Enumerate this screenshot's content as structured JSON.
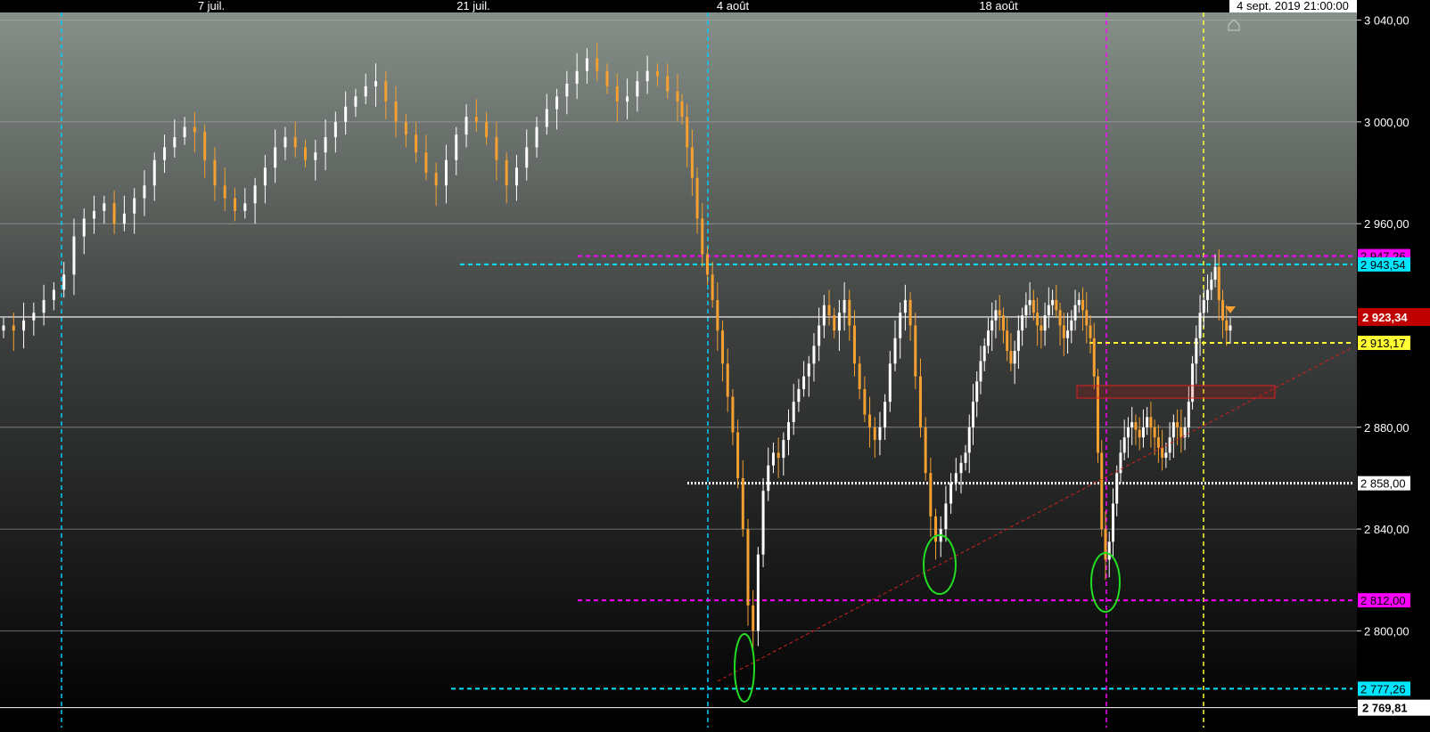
{
  "chart_data": {
    "type": "candlestick",
    "x_ticks": [
      "7 juil.",
      "21 juil.",
      "4 août",
      "18 août"
    ],
    "cursor_label": "4 sept. 2019 21:00:00",
    "y_ticks": [
      "3 040,00",
      "3 000,00",
      "2 960,00",
      "2 880,00",
      "2 840,00",
      "2 800,00"
    ],
    "ylim": [
      2762,
      3043
    ],
    "last_price": {
      "value": 2923.34,
      "label": "2 923,34"
    },
    "bottom_value": {
      "value": 2769.81,
      "label": "2 769,81"
    },
    "levels": [
      {
        "value": 2947.26,
        "label": "2 947,26",
        "color": "#ff00ff",
        "style": "dashed"
      },
      {
        "value": 2944.0,
        "label": "2 943,54",
        "color": "#00e5ff",
        "style": "dashed"
      },
      {
        "value": 2913.17,
        "label": "2 913,17",
        "color": "#ffff33",
        "style": "dashed"
      },
      {
        "value": 2858.0,
        "label": "2 858,00",
        "color": "#ffffff",
        "style": "dotted"
      },
      {
        "value": 2812.0,
        "label": "2 812,00",
        "color": "#ff00ff",
        "style": "dashed"
      },
      {
        "value": 2777.26,
        "label": "2 777,26",
        "color": "#00e5ff",
        "style": "dashed"
      }
    ],
    "series": [
      {
        "trend": "jul-up",
        "values": [
          2920,
          2918,
          2922,
          2925,
          2930,
          2934,
          2940,
          2955,
          2962,
          2965,
          2968,
          2960,
          2964,
          2970,
          2975,
          2985,
          2990,
          2994,
          2998,
          2996,
          2985,
          2975,
          2970,
          2965,
          2968,
          2975,
          2982,
          2990,
          2994,
          2990,
          2985,
          2988,
          2994,
          3000,
          3006,
          3010,
          3014,
          3016,
          3008,
          3000,
          2995,
          2988,
          2980,
          2975,
          2985,
          2995,
          3002,
          3000,
          2994,
          2985,
          2975,
          2982,
          2990,
          2998,
          3005,
          3010,
          3015,
          3020,
          3025,
          3020,
          3014,
          3008,
          3010,
          3016,
          3020,
          3018,
          3012,
          3008
        ]
      },
      {
        "trend": "aug-drop",
        "values": [
          3002,
          2990,
          2978,
          2962,
          2948,
          2940,
          2930,
          2918,
          2905,
          2892,
          2878,
          2860,
          2840,
          2810,
          2800,
          2830,
          2855,
          2865,
          2870,
          2868,
          2875,
          2882,
          2890,
          2895,
          2900,
          2905,
          2912,
          2920,
          2928,
          2924,
          2918,
          2925,
          2930,
          2920,
          2905,
          2895,
          2885,
          2880,
          2875,
          2880,
          2890,
          2905,
          2915,
          2925,
          2930,
          2920,
          2900,
          2880,
          2862,
          2845,
          2835,
          2840,
          2850,
          2858,
          2862,
          2866
        ]
      },
      {
        "trend": "aug-rally",
        "values": [
          2870,
          2880,
          2890,
          2898,
          2906,
          2912,
          2918,
          2922,
          2926,
          2924,
          2918,
          2910,
          2905,
          2910,
          2918,
          2924,
          2928,
          2930,
          2925,
          2920,
          2918,
          2924,
          2928,
          2930,
          2926,
          2920,
          2915,
          2918,
          2922,
          2928,
          2930,
          2926,
          2920,
          2915,
          2900,
          2870,
          2840,
          2828,
          2835,
          2850,
          2862,
          2870,
          2876,
          2880,
          2882,
          2879,
          2876,
          2880,
          2884,
          2880,
          2876,
          2872,
          2868,
          2870,
          2876,
          2882,
          2880,
          2876,
          2880,
          2890,
          2905,
          2915,
          2925,
          2930,
          2934,
          2938,
          2943,
          2930,
          2922,
          2918,
          2920
        ]
      }
    ],
    "marker_color_up": "#ffffff",
    "marker_color_down": "#f5a030",
    "grid": true
  }
}
